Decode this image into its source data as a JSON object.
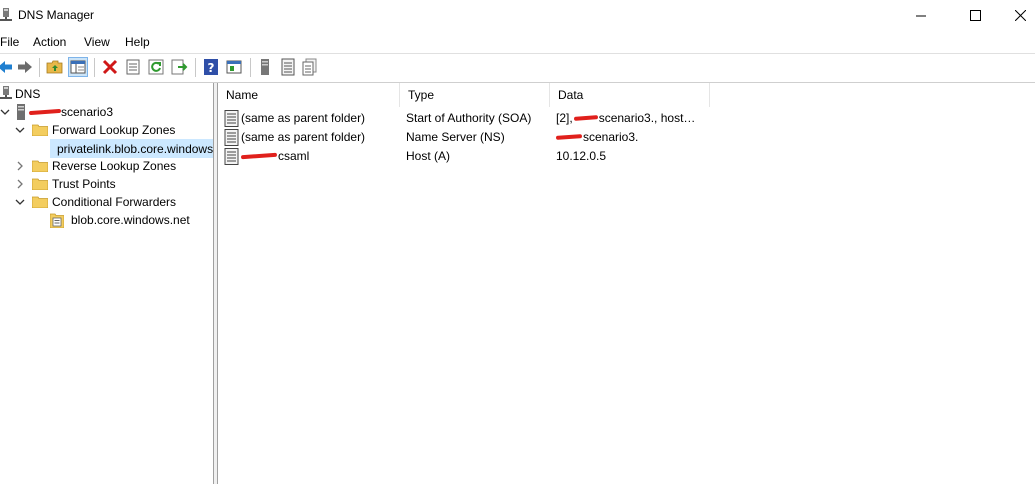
{
  "window": {
    "title": "DNS Manager"
  },
  "menu": [
    "File",
    "Action",
    "View",
    "Help"
  ],
  "tree": {
    "root": "DNS",
    "server": "scenario3",
    "forward_zones": "Forward Lookup Zones",
    "zone_selected": "privatelink.blob.core.windows.net",
    "reverse_zones": "Reverse Lookup Zones",
    "trust_points": "Trust Points",
    "conditional_forwarders": "Conditional Forwarders",
    "forwarder_zone": "blob.core.windows.net"
  },
  "list": {
    "columns": [
      "Name",
      "Type",
      "Data"
    ],
    "rows": [
      {
        "name": "(same as parent folder)",
        "type": "Start of Authority (SOA)",
        "data": "[2], ",
        "data_suffix": "scenario3., host…"
      },
      {
        "name": "(same as parent folder)",
        "type": "Name Server (NS)",
        "data": "",
        "data_suffix": "scenario3."
      },
      {
        "name": "",
        "name_suffix": "csaml",
        "type": "Host (A)",
        "data": "10.12.0.5",
        "data_suffix": ""
      }
    ]
  },
  "colors": {
    "selection": "#cce8ff",
    "redaction": "#e0201c"
  }
}
